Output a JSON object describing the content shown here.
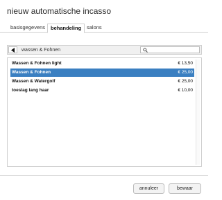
{
  "dialog": {
    "title": "nieuw automatische incasso"
  },
  "tabs": [
    {
      "label": "basisgegevens",
      "active": false
    },
    {
      "label": "behandeling",
      "active": true
    },
    {
      "label": "salons",
      "active": false
    }
  ],
  "toolbar": {
    "back_icon": "arrow-left-icon",
    "breadcrumb": "wassen & Fohnen",
    "search_icon": "search-icon",
    "search_value": "",
    "search_placeholder": ""
  },
  "items": [
    {
      "name": "Wassen & Fohnen light",
      "price": "€ 13,50",
      "selected": false
    },
    {
      "name": "Wassen & Fohnen",
      "price": "€ 25,00",
      "selected": true
    },
    {
      "name": "Wassen & Watergolf",
      "price": "€ 25,00",
      "selected": false
    },
    {
      "name": "toeslag lang haar",
      "price": "€ 10,00",
      "selected": false
    }
  ],
  "buttons": {
    "cancel": "annuleer",
    "save": "bewaar"
  },
  "colors": {
    "selection": "#3a7fc1",
    "border": "#cfcfcf"
  }
}
